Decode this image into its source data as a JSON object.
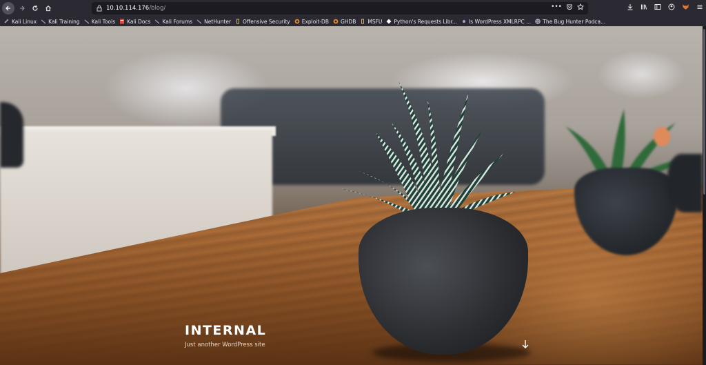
{
  "browser": {
    "url_host": "10.10.114.176",
    "url_path": "/blog/",
    "bookmarks": [
      {
        "label": "Kali Linux",
        "icon": "kali-dragon-icon"
      },
      {
        "label": "Kali Training",
        "icon": "kali-dragon-icon"
      },
      {
        "label": "Kali Tools",
        "icon": "kali-dragon-icon"
      },
      {
        "label": "Kali Docs",
        "icon": "kali-docs-icon"
      },
      {
        "label": "Kali Forums",
        "icon": "kali-dragon-icon"
      },
      {
        "label": "NetHunter",
        "icon": "kali-dragon-icon"
      },
      {
        "label": "Offensive Security",
        "icon": "offsec-icon"
      },
      {
        "label": "Exploit-DB",
        "icon": "exploit-db-icon"
      },
      {
        "label": "GHDB",
        "icon": "exploit-db-icon"
      },
      {
        "label": "MSFU",
        "icon": "offsec-icon"
      },
      {
        "label": "Python's Requests Libr...",
        "icon": "python-icon"
      },
      {
        "label": "Is WordPress XMLRPC ...",
        "icon": "globe-icon"
      },
      {
        "label": "The Bug Hunter Podca...",
        "icon": "globe-icon"
      }
    ]
  },
  "page": {
    "site_title": "INTERNAL",
    "site_description": "Just another WordPress site"
  }
}
